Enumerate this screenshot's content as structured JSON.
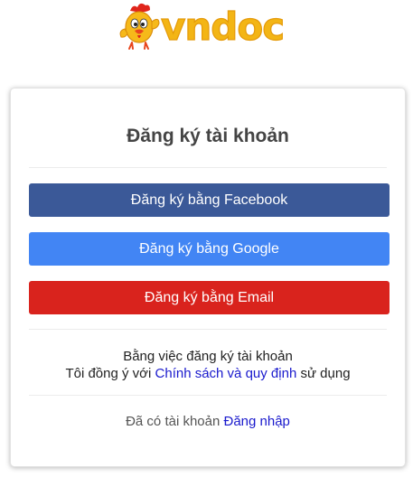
{
  "brand": {
    "logo_text": "vndoc",
    "logo_color": "#f3b515"
  },
  "card": {
    "title": "Đăng ký tài khoản",
    "buttons": {
      "facebook": {
        "label": "Đăng ký bằng Facebook",
        "color": "#3b5998"
      },
      "google": {
        "label": "Đăng ký bằng Google",
        "color": "#4285f4"
      },
      "email": {
        "label": "Đăng ký bằng Email",
        "color": "#d9231d"
      }
    },
    "terms": {
      "line1": "Bằng việc đăng ký tài khoản",
      "line2_prefix": "Tôi đồng ý với",
      "link": "Chính sách và quy định",
      "line2_suffix": "sử dụng"
    },
    "login": {
      "prompt": "Đã có tài khoản",
      "link": "Đăng nhập"
    }
  }
}
